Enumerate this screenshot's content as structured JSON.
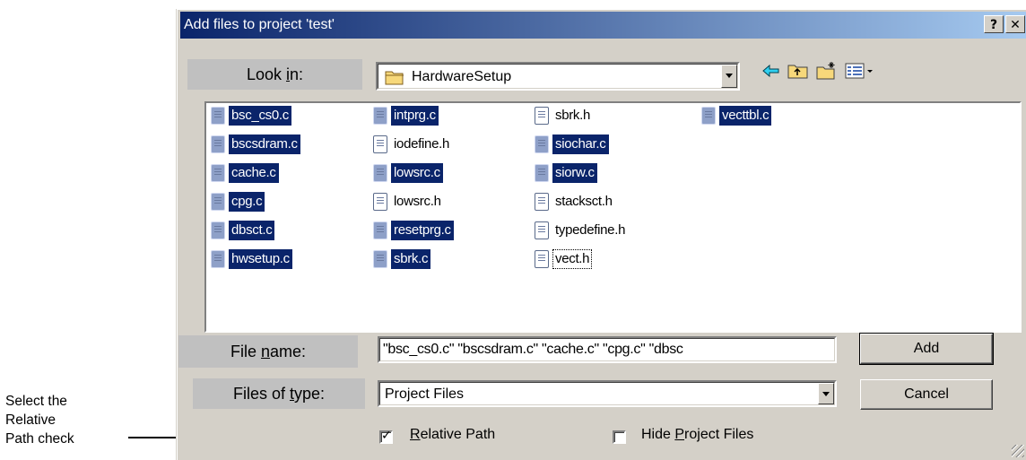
{
  "annotation": {
    "lines": [
      "Select   the",
      "Relative",
      "Path check"
    ]
  },
  "dialog": {
    "title": "Add files to project 'test'",
    "help_button": "?",
    "close_button": "✕"
  },
  "look_in": {
    "label_pre": "Look ",
    "label_key": "i",
    "label_post": "n:",
    "value": "HardwareSetup",
    "icon": "folder-icon"
  },
  "toolbar": {
    "icons": [
      "back-arrow-icon",
      "up-folder-icon",
      "new-folder-icon",
      "view-menu-icon"
    ]
  },
  "files": {
    "columns": [
      [
        {
          "name": "bsc_cs0.c",
          "selected": true
        },
        {
          "name": "bscsdram.c",
          "selected": true
        },
        {
          "name": "cache.c",
          "selected": true
        },
        {
          "name": "cpg.c",
          "selected": true
        },
        {
          "name": "dbsct.c",
          "selected": true
        },
        {
          "name": "hwsetup.c",
          "selected": true
        }
      ],
      [
        {
          "name": "intprg.c",
          "selected": true
        },
        {
          "name": "iodefine.h",
          "selected": false
        },
        {
          "name": "lowsrc.c",
          "selected": true
        },
        {
          "name": "lowsrc.h",
          "selected": false
        },
        {
          "name": "resetprg.c",
          "selected": true
        },
        {
          "name": "sbrk.c",
          "selected": true
        }
      ],
      [
        {
          "name": "sbrk.h",
          "selected": false
        },
        {
          "name": "siochar.c",
          "selected": true
        },
        {
          "name": "siorw.c",
          "selected": true
        },
        {
          "name": "stacksct.h",
          "selected": false
        },
        {
          "name": "typedefine.h",
          "selected": false
        },
        {
          "name": "vect.h",
          "selected": false,
          "focused": true
        }
      ],
      [
        {
          "name": "vecttbl.c",
          "selected": true
        }
      ]
    ]
  },
  "file_name": {
    "label_pre": "File ",
    "label_key": "n",
    "label_post": "ame:",
    "value": "\"bsc_cs0.c\" \"bscsdram.c\" \"cache.c\" \"cpg.c\" \"dbsc"
  },
  "files_of_type": {
    "label_pre": "Files of ",
    "label_key": "t",
    "label_post": "ype:",
    "value": "Project Files"
  },
  "buttons": {
    "add": "Add",
    "cancel": "Cancel"
  },
  "options": {
    "relative_path": {
      "key": "R",
      "rest": "elative Path",
      "checked": true
    },
    "hide_project_files": {
      "pre": "Hide ",
      "key": "P",
      "rest": "roject Files",
      "checked": false
    }
  },
  "colors": {
    "title_start": "#0a246a",
    "title_end": "#a6caf0",
    "selection": "#0a246a",
    "dialog_face": "#d4d0c8"
  }
}
